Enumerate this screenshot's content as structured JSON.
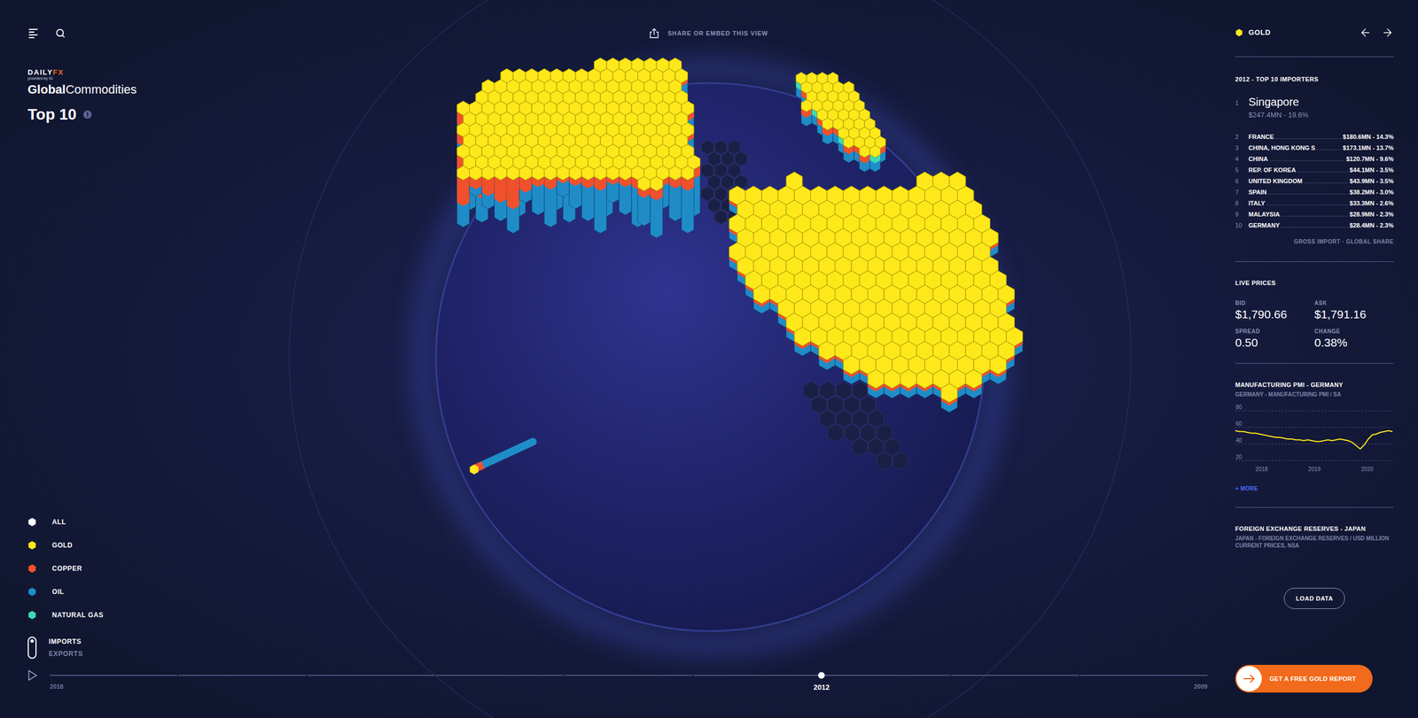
{
  "header": {
    "share": "SHARE OR EMBED THIS VIEW"
  },
  "logo": {
    "brand": "DAILY",
    "brand_accent": "FX",
    "tagline": "provided by IG",
    "title_bold": "Global",
    "title_regular": "Commodities"
  },
  "view": {
    "title": "Top 10"
  },
  "legend": [
    {
      "label": "ALL",
      "color": "#ffffff"
    },
    {
      "label": "GOLD",
      "color": "#ffe81a"
    },
    {
      "label": "COPPER",
      "color": "#f0502b"
    },
    {
      "label": "OIL",
      "color": "#1f8cc8"
    },
    {
      "label": "NATURAL GAS",
      "color": "#3ed9b2"
    }
  ],
  "flow_toggle": [
    {
      "label": "IMPORTS",
      "selected": true
    },
    {
      "label": "EXPORTS",
      "selected": false
    }
  ],
  "timeline": {
    "playing": false,
    "marks": [
      {
        "label": "2018",
        "selected": false
      },
      {
        "label": "",
        "selected": false
      },
      {
        "label": "",
        "selected": false
      },
      {
        "label": "",
        "selected": false
      },
      {
        "label": "",
        "selected": false
      },
      {
        "label": "",
        "selected": false
      },
      {
        "label": "2012",
        "selected": true
      },
      {
        "label": "",
        "selected": false
      },
      {
        "label": "",
        "selected": false
      },
      {
        "label": "2009",
        "selected": false
      }
    ]
  },
  "sidebar": {
    "commodity": "GOLD",
    "commodity_color": "#ffe81a",
    "importers_title": "2012 - TOP 10 IMPORTERS",
    "importers": [
      {
        "rank": "1",
        "country": "Singapore",
        "value": "$247.4MN - 19.6%"
      },
      {
        "rank": "2",
        "country": "FRANCE",
        "value": "$180.6MN - 14.3%"
      },
      {
        "rank": "3",
        "country": "CHINA, HONG KONG S",
        "value": "$173.1MN - 13.7%"
      },
      {
        "rank": "4",
        "country": "CHINA",
        "value": "$120.7MN - 9.6%"
      },
      {
        "rank": "5",
        "country": "REP. OF KOREA",
        "value": "$44.1MN - 3.5%"
      },
      {
        "rank": "6",
        "country": "UNITED KINGDOM",
        "value": "$43.9MN - 3.5%"
      },
      {
        "rank": "7",
        "country": "SPAIN",
        "value": "$38.2MN - 3.0%"
      },
      {
        "rank": "8",
        "country": "ITALY",
        "value": "$33.3MN - 2.6%"
      },
      {
        "rank": "9",
        "country": "MALAYSIA",
        "value": "$28.9MN - 2.3%"
      },
      {
        "rank": "10",
        "country": "GERMANY",
        "value": "$28.4MN - 2.3%"
      }
    ],
    "importers_footer": "GROSS IMPORT · GLOBAL SHARE",
    "live_prices": {
      "title": "LIVE PRICES",
      "items": [
        {
          "label": "BID",
          "value": "$1,790.66"
        },
        {
          "label": "ASK",
          "value": "$1,791.16"
        },
        {
          "label": "SPREAD",
          "value": "0.50"
        },
        {
          "label": "CHANGE",
          "value": "0.38%"
        }
      ]
    },
    "pmi_chart": {
      "title": "MANUFACTURING PMI - GERMANY",
      "subtitle": "GERMANY - MANUFACTURING PMI / SA",
      "y_ticks": [
        "80",
        "60",
        "40",
        "20"
      ],
      "x_ticks": [
        "2018",
        "2019",
        "2020"
      ],
      "color": "#ffe81a",
      "series": [
        56,
        55,
        55,
        54,
        53,
        53,
        52,
        51,
        50,
        49,
        48,
        48,
        47,
        46,
        46,
        45,
        45,
        44,
        45,
        44,
        43,
        43,
        44,
        45,
        44,
        45,
        46,
        45,
        44,
        42,
        38,
        34,
        39,
        46,
        51,
        52,
        54,
        55,
        56,
        55
      ]
    },
    "more": "+ MORE",
    "fx_reserves": {
      "title": "FOREIGN EXCHANGE RESERVES - JAPAN",
      "subtitle": "JAPAN - FOREIGN EXCHANGE RESERVES / USD MILLION CURRENT PRICES, NSA",
      "button": "LOAD DATA"
    },
    "cta": "GET A FREE GOLD REPORT"
  }
}
